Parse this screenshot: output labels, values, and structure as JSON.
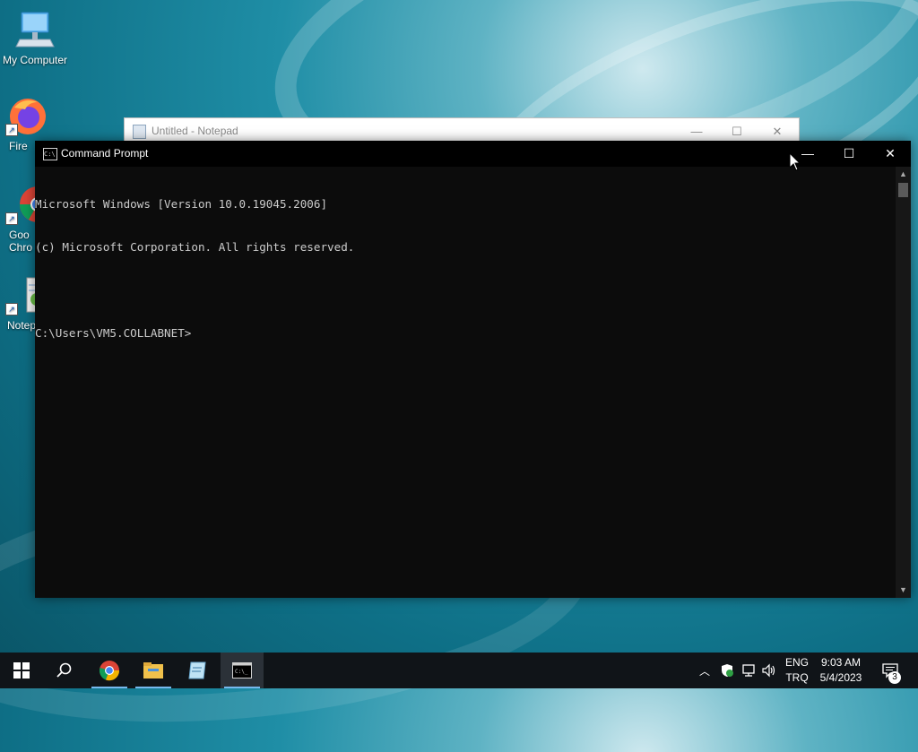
{
  "desktop": {
    "icons": [
      {
        "label": "My Computer"
      },
      {
        "label": "Fire"
      },
      {
        "label": "Goo\nChro"
      },
      {
        "label": "Notep"
      }
    ]
  },
  "notepad": {
    "title": "Untitled - Notepad"
  },
  "cmd": {
    "title": "Command Prompt",
    "lines": [
      "Microsoft Windows [Version 10.0.19045.2006]",
      "(c) Microsoft Corporation. All rights reserved.",
      "",
      "C:\\Users\\VM5.COLLABNET>"
    ]
  },
  "taskbar": {
    "items": [
      "start-icon",
      "search-icon",
      "chrome-icon",
      "file-explorer-icon",
      "notepad-icon",
      "command-prompt-icon"
    ],
    "tray": {
      "lang_line1": "ENG",
      "lang_line2": "TRQ",
      "time": "9:03 AM",
      "date": "5/4/2023",
      "notifications": "3"
    }
  },
  "colors": {
    "accent": "#76b9ed",
    "console_bg": "#0c0c0c",
    "console_text": "#cccccc"
  }
}
